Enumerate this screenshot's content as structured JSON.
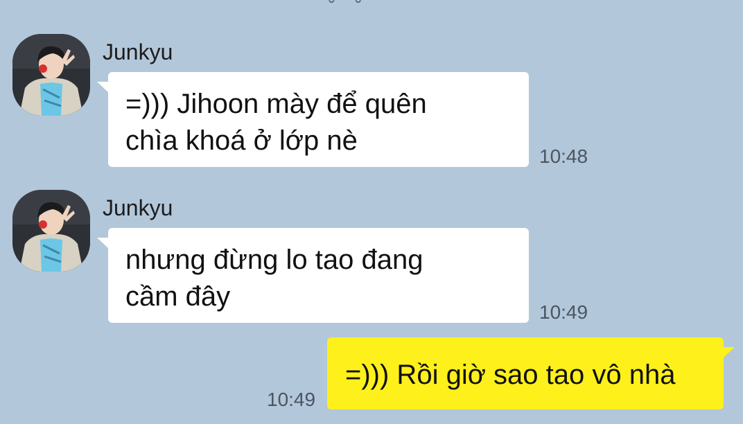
{
  "chat": {
    "messages": [
      {
        "sender": "Junkyu",
        "text": "=))) Jihoon mày để quên\nchìa khoá ở lớp nè",
        "time": "10:48",
        "outgoing": false
      },
      {
        "sender": "Junkyu",
        "text": "nhưng đừng lo tao đang\ncầm đây",
        "time": "10:49",
        "outgoing": false
      },
      {
        "sender": "",
        "text": "=))) Rồi giờ sao tao vô nhà",
        "time": "10:49",
        "outgoing": true
      }
    ]
  },
  "icons": {
    "avatar": "profile-photo-icon"
  },
  "colors": {
    "background": "#b2c7da",
    "incoming_bubble": "#ffffff",
    "outgoing_bubble": "#fef01b",
    "timestamp": "#4b5562"
  }
}
